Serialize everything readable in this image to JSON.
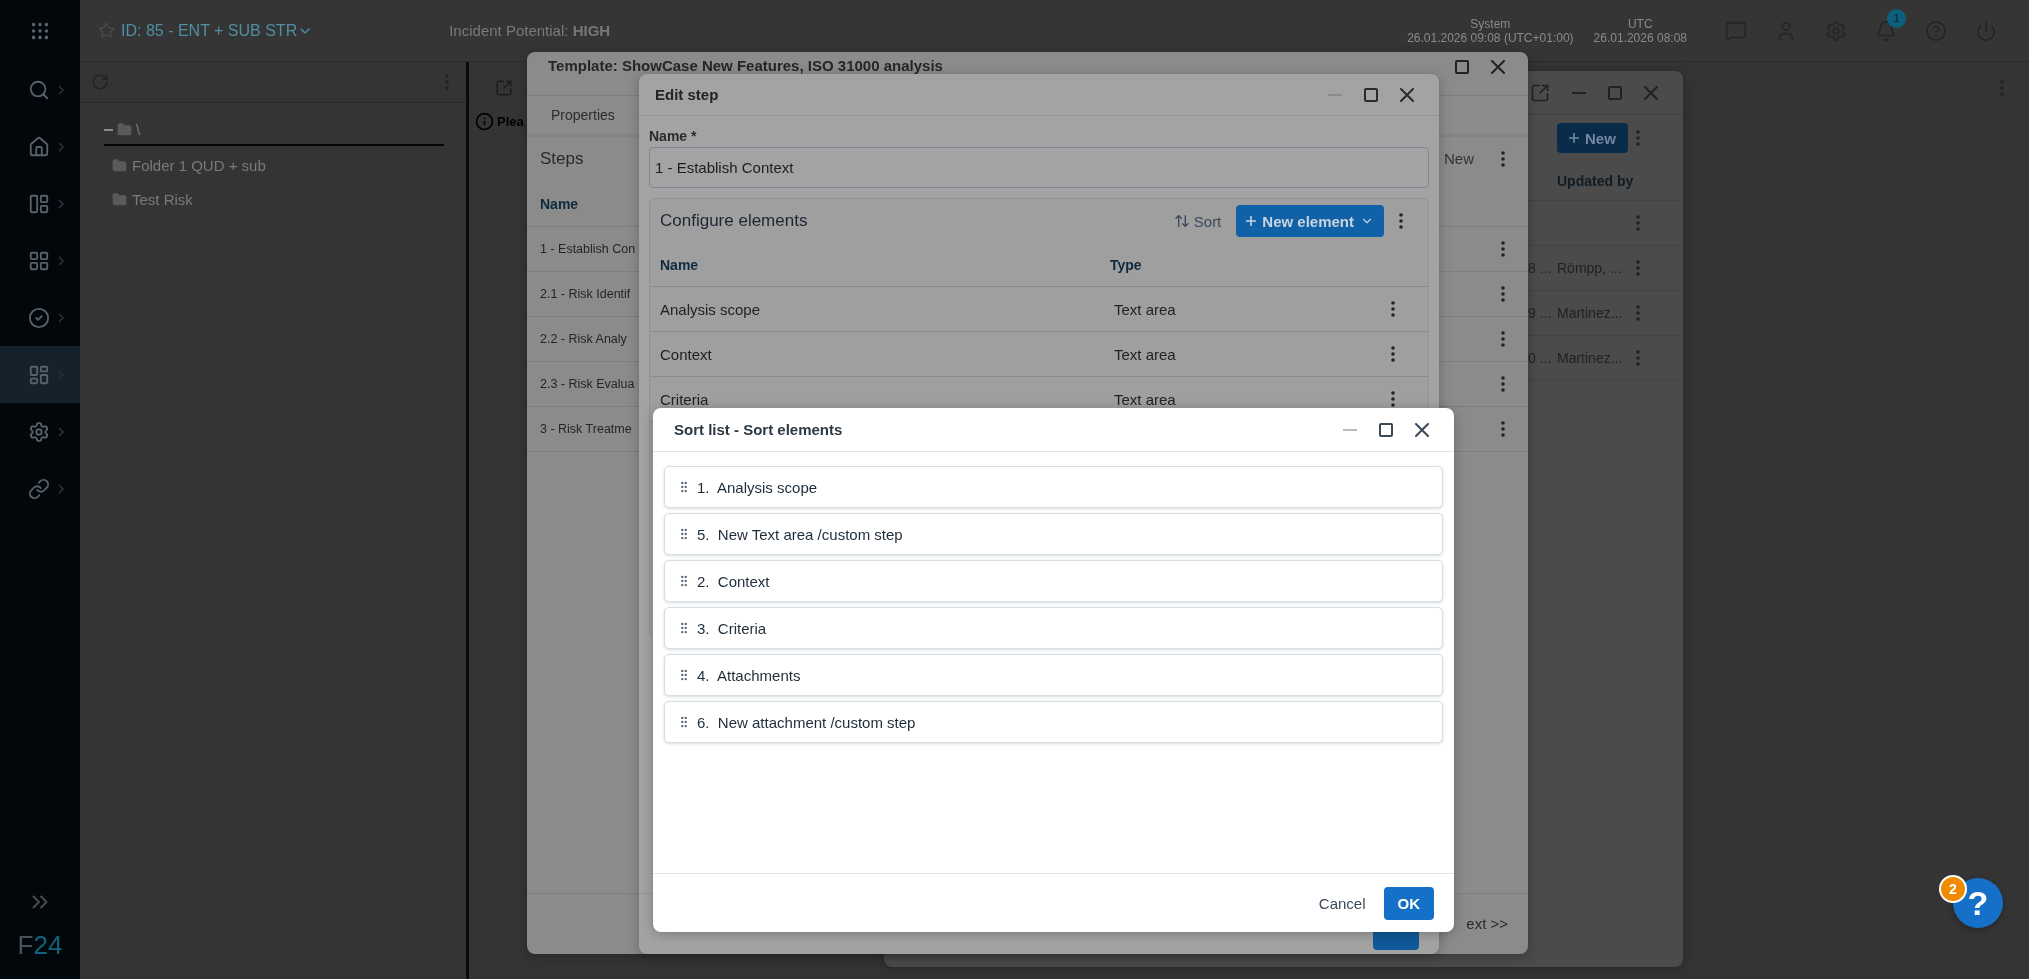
{
  "sidebar": {
    "items": [
      {
        "selected": false
      },
      {
        "selected": false
      },
      {
        "selected": false
      },
      {
        "selected": false
      },
      {
        "selected": false
      },
      {
        "selected": true
      },
      {
        "selected": false
      },
      {
        "selected": false
      }
    ],
    "logo": [
      "F",
      "24"
    ]
  },
  "header": {
    "title": "ID: 85 - ENT + SUB STR",
    "incident": "Incident Potential: **HIGH**",
    "clocks": [
      {
        "label": "System",
        "time": "26.01.2026 09:08 (UTC+01:00)"
      },
      {
        "label": "UTC",
        "time": "26.01.2026 08:08"
      }
    ],
    "notification_badge": "1"
  },
  "tree": {
    "label": "\\",
    "expanded": true,
    "children": [
      {
        "label": "Folder 1 QUD + sub"
      },
      {
        "label": "Test Risk"
      }
    ]
  },
  "main": {
    "info_text": "Plea"
  },
  "list_window": {
    "new_button": "New",
    "columns": [
      "Updated by"
    ],
    "rows": [
      {
        "column_1": "8 ...",
        "updated_by": "Römpp, ..."
      },
      {
        "column_1": "9 ...",
        "updated_by": "Martinez..."
      },
      {
        "column_1": "0 ...",
        "updated_by": "Martinez..."
      }
    ]
  },
  "template_window": {
    "title": "Template: ShowCase New Features, ISO 31000 analysis",
    "tabs": [
      {
        "label": "Properties",
        "selected": false
      }
    ],
    "steps_title": "Steps",
    "new_label": "New",
    "columns": [
      "Name"
    ],
    "rows": [
      {
        "name": "1 - Establish Con"
      },
      {
        "name": "2.1 - Risk Identif"
      },
      {
        "name": "2.2 - Risk Analy"
      },
      {
        "name": "2.3 - Risk Evalua"
      },
      {
        "name": "3 - Risk Treatme"
      }
    ],
    "next_label": "ext >>"
  },
  "edit_step": {
    "title": "Edit step",
    "name_label": "Name *",
    "name_value": "1 - Establish Context",
    "card_title": "Configure elements",
    "sort_label": "Sort",
    "new_element_label": "New element",
    "columns": [
      "Name",
      "Type"
    ],
    "rows": [
      {
        "name": "Analysis scope",
        "type": "Text area"
      },
      {
        "name": "Context",
        "type": "Text area"
      },
      {
        "name": "Criteria",
        "type": "Text area"
      }
    ]
  },
  "sort_dialog": {
    "title": "Sort list - Sort elements",
    "items": [
      {
        "label": "1.  Analysis scope"
      },
      {
        "label": "5.  New Text area /custom step"
      },
      {
        "label": "2.  Context"
      },
      {
        "label": "3.  Criteria"
      },
      {
        "label": "4.  Attachments"
      },
      {
        "label": "6.  New attachment /custom step"
      }
    ],
    "cancel": "Cancel",
    "ok": "OK"
  },
  "help": {
    "symbol": "?",
    "badge": "2"
  }
}
